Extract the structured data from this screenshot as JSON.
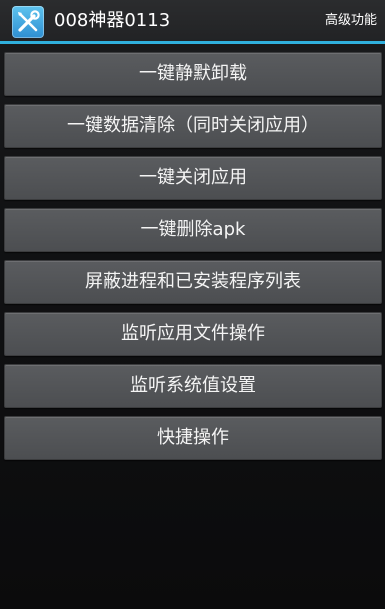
{
  "app": {
    "title": "008神器0113",
    "icon": "tools-icon",
    "accent_color": "#30b0dd"
  },
  "menu": {
    "advanced_label": "高级功能"
  },
  "buttons": [
    {
      "label": "一键静默卸载"
    },
    {
      "label": "一键数据清除（同时关闭应用）"
    },
    {
      "label": "一键关闭应用"
    },
    {
      "label": "一键删除apk"
    },
    {
      "label": "屏蔽进程和已安装程序列表"
    },
    {
      "label": "监听应用文件操作"
    },
    {
      "label": "监听系统值设置"
    },
    {
      "label": "快捷操作"
    }
  ]
}
